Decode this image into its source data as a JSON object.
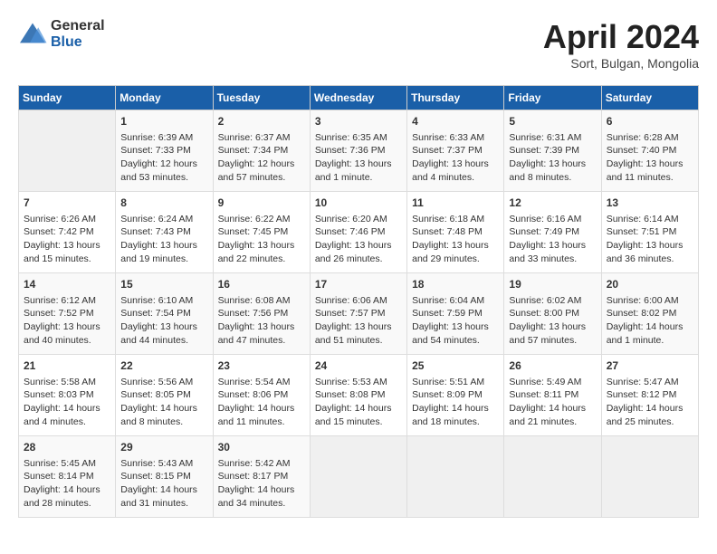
{
  "header": {
    "logo_general": "General",
    "logo_blue": "Blue",
    "month_title": "April 2024",
    "location": "Sort, Bulgan, Mongolia"
  },
  "days_of_week": [
    "Sunday",
    "Monday",
    "Tuesday",
    "Wednesday",
    "Thursday",
    "Friday",
    "Saturday"
  ],
  "weeks": [
    [
      {
        "day": "",
        "info": ""
      },
      {
        "day": "1",
        "info": "Sunrise: 6:39 AM\nSunset: 7:33 PM\nDaylight: 12 hours\nand 53 minutes."
      },
      {
        "day": "2",
        "info": "Sunrise: 6:37 AM\nSunset: 7:34 PM\nDaylight: 12 hours\nand 57 minutes."
      },
      {
        "day": "3",
        "info": "Sunrise: 6:35 AM\nSunset: 7:36 PM\nDaylight: 13 hours\nand 1 minute."
      },
      {
        "day": "4",
        "info": "Sunrise: 6:33 AM\nSunset: 7:37 PM\nDaylight: 13 hours\nand 4 minutes."
      },
      {
        "day": "5",
        "info": "Sunrise: 6:31 AM\nSunset: 7:39 PM\nDaylight: 13 hours\nand 8 minutes."
      },
      {
        "day": "6",
        "info": "Sunrise: 6:28 AM\nSunset: 7:40 PM\nDaylight: 13 hours\nand 11 minutes."
      }
    ],
    [
      {
        "day": "7",
        "info": "Sunrise: 6:26 AM\nSunset: 7:42 PM\nDaylight: 13 hours\nand 15 minutes."
      },
      {
        "day": "8",
        "info": "Sunrise: 6:24 AM\nSunset: 7:43 PM\nDaylight: 13 hours\nand 19 minutes."
      },
      {
        "day": "9",
        "info": "Sunrise: 6:22 AM\nSunset: 7:45 PM\nDaylight: 13 hours\nand 22 minutes."
      },
      {
        "day": "10",
        "info": "Sunrise: 6:20 AM\nSunset: 7:46 PM\nDaylight: 13 hours\nand 26 minutes."
      },
      {
        "day": "11",
        "info": "Sunrise: 6:18 AM\nSunset: 7:48 PM\nDaylight: 13 hours\nand 29 minutes."
      },
      {
        "day": "12",
        "info": "Sunrise: 6:16 AM\nSunset: 7:49 PM\nDaylight: 13 hours\nand 33 minutes."
      },
      {
        "day": "13",
        "info": "Sunrise: 6:14 AM\nSunset: 7:51 PM\nDaylight: 13 hours\nand 36 minutes."
      }
    ],
    [
      {
        "day": "14",
        "info": "Sunrise: 6:12 AM\nSunset: 7:52 PM\nDaylight: 13 hours\nand 40 minutes."
      },
      {
        "day": "15",
        "info": "Sunrise: 6:10 AM\nSunset: 7:54 PM\nDaylight: 13 hours\nand 44 minutes."
      },
      {
        "day": "16",
        "info": "Sunrise: 6:08 AM\nSunset: 7:56 PM\nDaylight: 13 hours\nand 47 minutes."
      },
      {
        "day": "17",
        "info": "Sunrise: 6:06 AM\nSunset: 7:57 PM\nDaylight: 13 hours\nand 51 minutes."
      },
      {
        "day": "18",
        "info": "Sunrise: 6:04 AM\nSunset: 7:59 PM\nDaylight: 13 hours\nand 54 minutes."
      },
      {
        "day": "19",
        "info": "Sunrise: 6:02 AM\nSunset: 8:00 PM\nDaylight: 13 hours\nand 57 minutes."
      },
      {
        "day": "20",
        "info": "Sunrise: 6:00 AM\nSunset: 8:02 PM\nDaylight: 14 hours\nand 1 minute."
      }
    ],
    [
      {
        "day": "21",
        "info": "Sunrise: 5:58 AM\nSunset: 8:03 PM\nDaylight: 14 hours\nand 4 minutes."
      },
      {
        "day": "22",
        "info": "Sunrise: 5:56 AM\nSunset: 8:05 PM\nDaylight: 14 hours\nand 8 minutes."
      },
      {
        "day": "23",
        "info": "Sunrise: 5:54 AM\nSunset: 8:06 PM\nDaylight: 14 hours\nand 11 minutes."
      },
      {
        "day": "24",
        "info": "Sunrise: 5:53 AM\nSunset: 8:08 PM\nDaylight: 14 hours\nand 15 minutes."
      },
      {
        "day": "25",
        "info": "Sunrise: 5:51 AM\nSunset: 8:09 PM\nDaylight: 14 hours\nand 18 minutes."
      },
      {
        "day": "26",
        "info": "Sunrise: 5:49 AM\nSunset: 8:11 PM\nDaylight: 14 hours\nand 21 minutes."
      },
      {
        "day": "27",
        "info": "Sunrise: 5:47 AM\nSunset: 8:12 PM\nDaylight: 14 hours\nand 25 minutes."
      }
    ],
    [
      {
        "day": "28",
        "info": "Sunrise: 5:45 AM\nSunset: 8:14 PM\nDaylight: 14 hours\nand 28 minutes."
      },
      {
        "day": "29",
        "info": "Sunrise: 5:43 AM\nSunset: 8:15 PM\nDaylight: 14 hours\nand 31 minutes."
      },
      {
        "day": "30",
        "info": "Sunrise: 5:42 AM\nSunset: 8:17 PM\nDaylight: 14 hours\nand 34 minutes."
      },
      {
        "day": "",
        "info": ""
      },
      {
        "day": "",
        "info": ""
      },
      {
        "day": "",
        "info": ""
      },
      {
        "day": "",
        "info": ""
      }
    ]
  ]
}
